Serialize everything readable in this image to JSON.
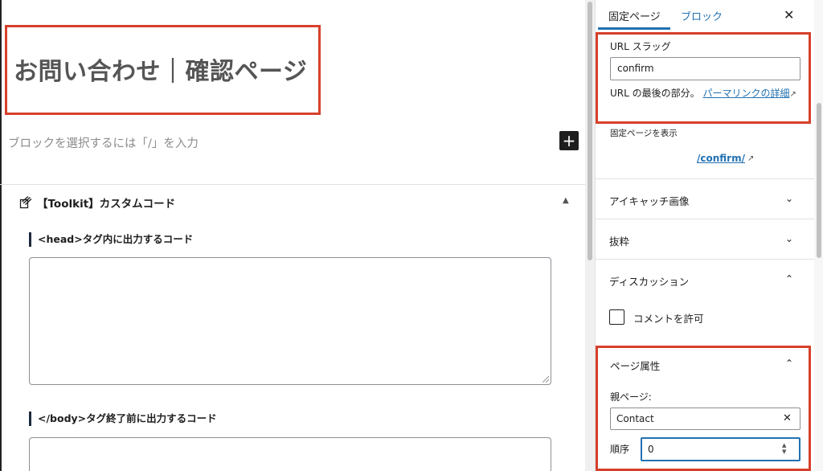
{
  "editor": {
    "page_title": "お問い合わせ｜確認ページ",
    "block_placeholder": "ブロックを選択するには「/」を入力",
    "add_block_symbol": "+",
    "meta_box": {
      "title": "【Toolkit】カスタムコード",
      "toggle_symbol": "▲",
      "head_label": "<head>タグ内に出力するコード",
      "head_value": "",
      "body_label": "</body>タグ終了前に出力するコード",
      "body_value": ""
    }
  },
  "sidebar": {
    "tabs": {
      "page": "固定ページ",
      "block": "ブロック"
    },
    "close_symbol": "✕",
    "slug": {
      "label": "URL スラッグ",
      "value": "confirm",
      "help_prefix": "URL の最後の部分。",
      "help_link": "パーマリンクの詳細",
      "external_symbol": "↗"
    },
    "view_page": {
      "label": "固定ページを表示",
      "link": "/confirm/",
      "external_symbol": "↗"
    },
    "panels": {
      "featured_image": {
        "title": "アイキャッチ画像",
        "chevron": "⌄"
      },
      "excerpt": {
        "title": "抜粋",
        "chevron": "⌄"
      },
      "discussion": {
        "title": "ディスカッション",
        "chevron": "⌃",
        "comment_label": "コメントを許可"
      }
    },
    "attributes": {
      "title": "ページ属性",
      "chevron": "⌃",
      "parent_label": "親ページ:",
      "parent_value": "Contact",
      "clear_symbol": "✕",
      "order_label": "順序",
      "order_value": "0"
    }
  },
  "colors": {
    "highlight_border": "#d6402b",
    "link": "#2271b1",
    "dark": "#1e1e1e"
  }
}
